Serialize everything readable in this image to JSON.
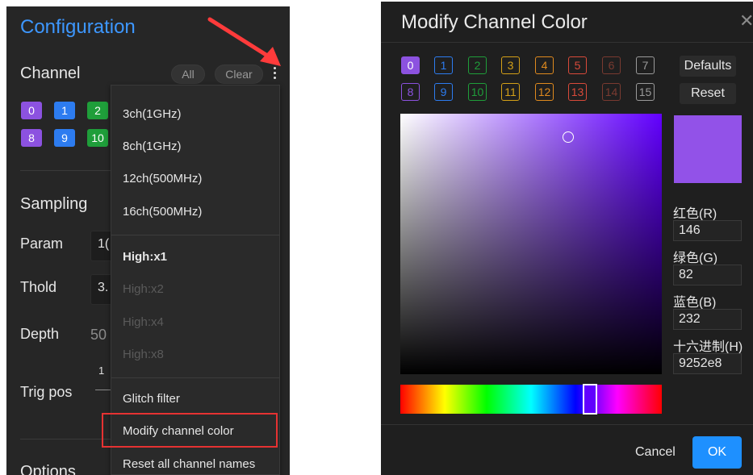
{
  "config_panel": {
    "title": "Configuration",
    "channel_section": {
      "label": "Channel",
      "all_button": "All",
      "clear_button": "Clear",
      "menu_icon": "kebab-menu-icon",
      "chips": [
        {
          "label": "0",
          "color": "#8c52e0"
        },
        {
          "label": "1",
          "color": "#2d7cf0"
        },
        {
          "label": "2",
          "color": "#1f9e3a"
        },
        {
          "label": "8",
          "color": "#8c52e0"
        },
        {
          "label": "9",
          "color": "#2d7cf0"
        },
        {
          "label": "10",
          "color": "#1f9e3a"
        }
      ]
    },
    "sampling_section": {
      "label": "Sampling",
      "param_label": "Param",
      "param_value": "1(",
      "thold_label": "Thold",
      "thold_value": "3.",
      "depth_label": "Depth",
      "depth_value": "50",
      "trig_pos_label": "Trig pos",
      "trig_pos_value": "1"
    },
    "options_label": "Options"
  },
  "dropdown_menu": {
    "items": [
      {
        "label": "3ch(1GHz)"
      },
      {
        "label": "8ch(1GHz)"
      },
      {
        "label": "12ch(500MHz)"
      },
      {
        "label": "16ch(500MHz)"
      },
      {
        "label": "High:x1"
      },
      {
        "label": "High:x2"
      },
      {
        "label": "High:x4"
      },
      {
        "label": "High:x8"
      },
      {
        "label": "Glitch filter"
      },
      {
        "label": "Modify channel color"
      },
      {
        "label": "Reset all channel names"
      }
    ]
  },
  "color_dialog": {
    "title": "Modify Channel Color",
    "close_icon": "close-icon",
    "swatches_row1": [
      {
        "label": "0",
        "color": "#8c52e0",
        "selected": true
      },
      {
        "label": "1",
        "color": "#2d7cf0"
      },
      {
        "label": "2",
        "color": "#1f9e3a"
      },
      {
        "label": "3",
        "color": "#d4a017"
      },
      {
        "label": "4",
        "color": "#e08a1e"
      },
      {
        "label": "5",
        "color": "#d94a3a"
      },
      {
        "label": "6",
        "color": "#7a3a30"
      },
      {
        "label": "7",
        "color": "#9a9a9a"
      }
    ],
    "swatches_row2": [
      {
        "label": "8",
        "color": "#8c52e0"
      },
      {
        "label": "9",
        "color": "#2d7cf0"
      },
      {
        "label": "10",
        "color": "#1f9e3a"
      },
      {
        "label": "11",
        "color": "#d4a017"
      },
      {
        "label": "12",
        "color": "#e08a1e"
      },
      {
        "label": "13",
        "color": "#d94a3a"
      },
      {
        "label": "14",
        "color": "#7a3a30"
      },
      {
        "label": "15",
        "color": "#9a9a9a"
      }
    ],
    "defaults_button": "Defaults",
    "reset_button": "Reset",
    "preview_color": "#9252e8",
    "red_label": "红色(R)",
    "red_value": "146",
    "green_label": "绿色(G)",
    "green_value": "82",
    "blue_label": "蓝色(B)",
    "blue_value": "232",
    "hex_label": "十六进制(H)",
    "hex_value": "9252e8",
    "cancel_button": "Cancel",
    "ok_button": "OK"
  }
}
